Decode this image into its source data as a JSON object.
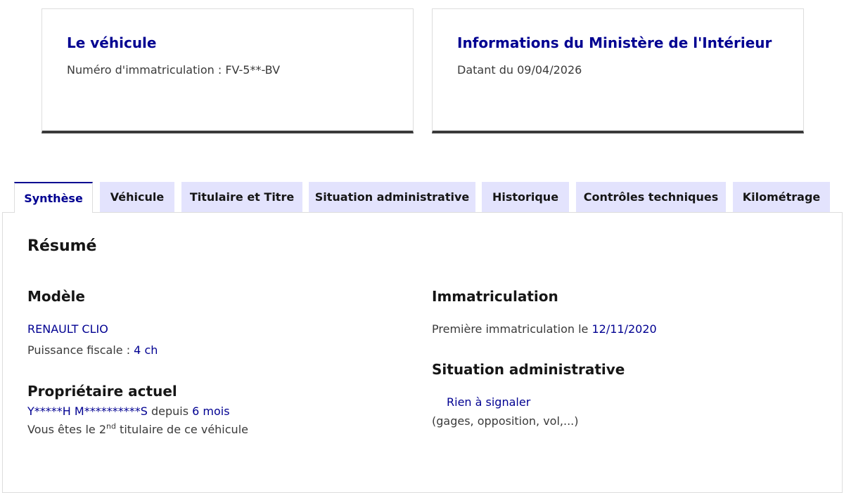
{
  "vehicle_card": {
    "title": "Le véhicule",
    "plate_label": "Numéro d'immatriculation : ",
    "plate_value": "FV-5**-BV"
  },
  "ministry_card": {
    "title": "Informations du Ministère de l'Intérieur",
    "date_text": "Datant du 09/04/2026"
  },
  "tabs": [
    {
      "label": "Synthèse",
      "active": true
    },
    {
      "label": "Véhicule",
      "active": false
    },
    {
      "label": "Titulaire et Titre",
      "active": false
    },
    {
      "label": "Situation administrative",
      "active": false
    },
    {
      "label": "Historique",
      "active": false
    },
    {
      "label": "Contrôles techniques",
      "active": false
    },
    {
      "label": "Kilométrage",
      "active": false
    }
  ],
  "summary": {
    "title": "Résumé",
    "model": {
      "heading": "Modèle",
      "name": "RENAULT CLIO",
      "power_label": "Puissance fiscale : ",
      "power_value": "4 ch"
    },
    "owner": {
      "heading": "Propriétaire actuel",
      "name": "Y*****H M**********S",
      "since_label": " depuis ",
      "since_value": "6 mois",
      "rank_prefix": "Vous êtes le 2",
      "rank_sup": "nd",
      "rank_suffix": " titulaire de ce véhicule"
    },
    "registration": {
      "heading": "Immatriculation",
      "first_label": "Première immatriculation le ",
      "first_date": "12/11/2020"
    },
    "admin_status": {
      "heading": "Situation administrative",
      "status": "Rien à signaler",
      "details": "(gages, opposition, vol,...)"
    }
  },
  "colors": {
    "accent": "#000091",
    "tab_bg": "#e3e3fd",
    "text": "#3a3a3a",
    "heading": "#161616"
  }
}
